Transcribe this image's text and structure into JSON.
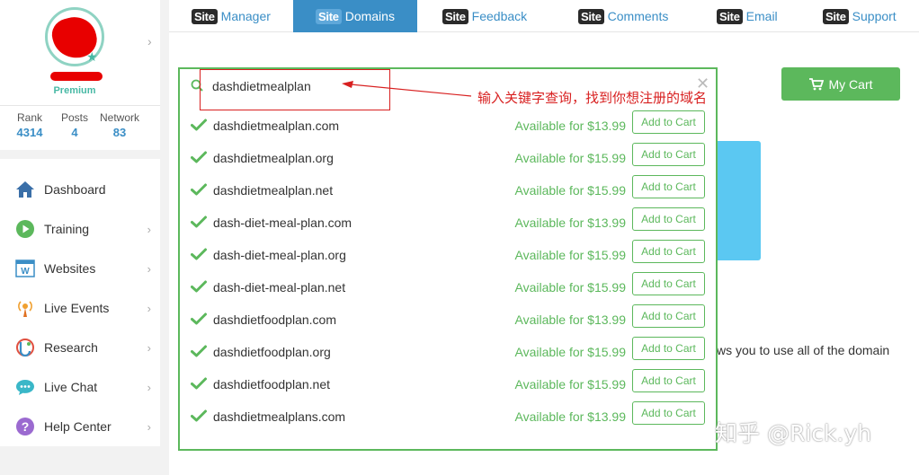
{
  "profile": {
    "tier": "Premium",
    "stats": [
      {
        "label": "Rank",
        "value": "4314"
      },
      {
        "label": "Posts",
        "value": "4"
      },
      {
        "label": "Network",
        "value": "83"
      }
    ]
  },
  "sidebar": {
    "items": [
      {
        "label": "Dashboard",
        "icon": "home-icon"
      },
      {
        "label": "Training",
        "icon": "play-icon"
      },
      {
        "label": "Websites",
        "icon": "website-icon"
      },
      {
        "label": "Live Events",
        "icon": "broadcast-icon"
      },
      {
        "label": "Research",
        "icon": "research-icon"
      },
      {
        "label": "Live Chat",
        "icon": "chat-icon"
      },
      {
        "label": "Help Center",
        "icon": "help-icon"
      }
    ]
  },
  "tabs": [
    {
      "badge": "Site",
      "label": "Manager"
    },
    {
      "badge": "Site",
      "label": "Domains",
      "active": true
    },
    {
      "badge": "Site",
      "label": "Feedback"
    },
    {
      "badge": "Site",
      "label": "Comments"
    },
    {
      "badge": "Site",
      "label": "Email"
    },
    {
      "badge": "Site",
      "label": "Support"
    }
  ],
  "cart": {
    "label": "My Cart"
  },
  "background_text": "ws you to use all of the domain",
  "search": {
    "value": "dashdietmealplan"
  },
  "annotation": "输入关键字查询，找到你想注册的域名",
  "add_label": "Add to Cart",
  "results": [
    {
      "domain": "dashdietmealplan.com",
      "price": "Available for $13.99"
    },
    {
      "domain": "dashdietmealplan.org",
      "price": "Available for $15.99"
    },
    {
      "domain": "dashdietmealplan.net",
      "price": "Available for $15.99"
    },
    {
      "domain": "dash-diet-meal-plan.com",
      "price": "Available for $13.99"
    },
    {
      "domain": "dash-diet-meal-plan.org",
      "price": "Available for $15.99"
    },
    {
      "domain": "dash-diet-meal-plan.net",
      "price": "Available for $15.99"
    },
    {
      "domain": "dashdietfoodplan.com",
      "price": "Available for $13.99"
    },
    {
      "domain": "dashdietfoodplan.org",
      "price": "Available for $15.99"
    },
    {
      "domain": "dashdietfoodplan.net",
      "price": "Available for $15.99"
    },
    {
      "domain": "dashdietmealplans.com",
      "price": "Available for $13.99"
    }
  ],
  "watermark": "知乎 @Rick.yh",
  "colors": {
    "accent": "#3a8ec6",
    "success": "#5cb85c",
    "annotation": "#d82020",
    "premium": "#48b9a5"
  }
}
